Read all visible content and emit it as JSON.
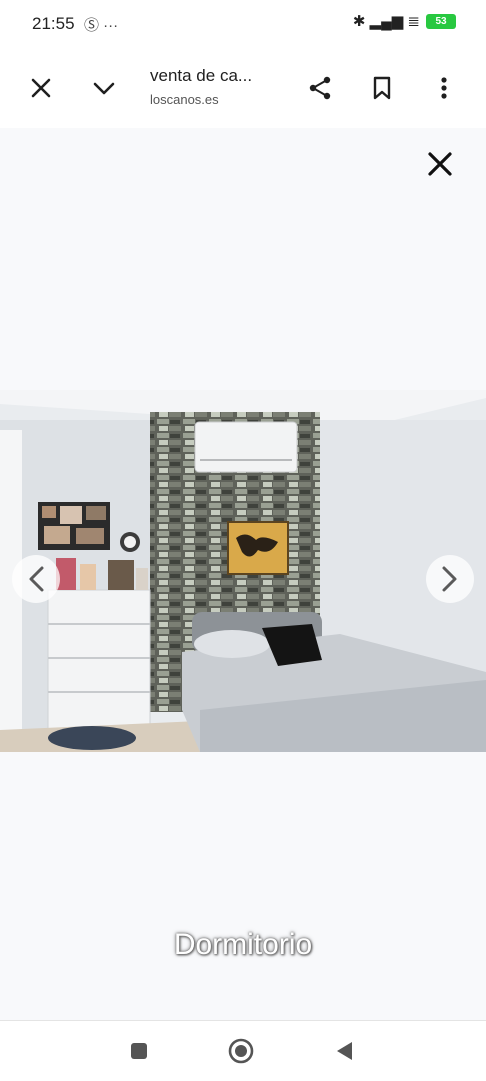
{
  "status_bar": {
    "time": "21:55",
    "left_icons": "Ⓢ ···",
    "right_icons": "✱ ▂▄▆ ≣",
    "battery": "53"
  },
  "toolbar": {
    "title": "venta de ca...",
    "url": "loscanos.es",
    "icons": [
      "close-icon",
      "chevron-down-icon",
      "share-icon",
      "bookmark-icon",
      "more-vert-icon"
    ]
  },
  "viewer": {
    "caption": "Dormitorio",
    "icons": [
      "close-icon",
      "chevron-left-icon",
      "chevron-right-icon"
    ]
  },
  "colors": {
    "page_bg": "#f8f9fb",
    "wall": "#e9ecef",
    "stone_wall": "#6e7166",
    "battery": "#28c840"
  },
  "nav_bar": {
    "icons": [
      "recents-square-icon",
      "home-circle-icon",
      "back-triangle-icon"
    ]
  }
}
